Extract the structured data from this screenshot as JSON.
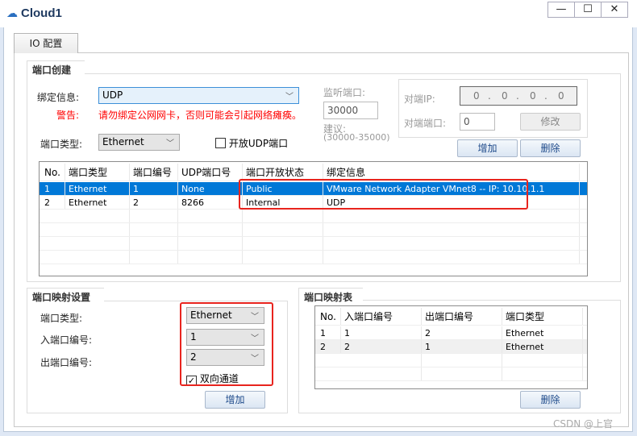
{
  "window": {
    "title": "Cloud1",
    "controls": [
      "—",
      "☐",
      "✕"
    ]
  },
  "tab": {
    "label": "IO 配置"
  },
  "creation": {
    "title": "端口创建",
    "bind_label": "绑定信息:",
    "bind_value": "UDP",
    "warning_label": "警告:",
    "warning_text": "请勿绑定公网网卡，否则可能会引起网络瘫痪。",
    "port_type_label": "端口类型:",
    "port_type_value": "Ethernet",
    "open_udp_label": "开放UDP端口",
    "open_udp_checked": false,
    "listen_label": "监听端口:",
    "listen_value": "30000",
    "suggest_label": "建议:",
    "suggest_range": "(30000-35000)",
    "peer_ip_label": "对端IP:",
    "peer_ip": [
      "0",
      "0",
      "0",
      "0"
    ],
    "peer_port_label": "对端端口:",
    "peer_port_value": "0",
    "modify_button": "修改",
    "add_button": "增加",
    "delete_button": "删除",
    "table": {
      "headers": [
        "No.",
        "端口类型",
        "端口编号",
        "UDP端口号",
        "端口开放状态",
        "绑定信息"
      ],
      "rows": [
        [
          "1",
          "Ethernet",
          "1",
          "None",
          "Public",
          "VMware Network Adapter VMnet8 -- IP: 10.10.1.1"
        ],
        [
          "2",
          "Ethernet",
          "2",
          "8266",
          "Internal",
          "UDP"
        ]
      ],
      "selected_row": 1
    }
  },
  "mapping": {
    "title": "端口映射设置",
    "port_type_label": "端口类型:",
    "port_type_value": "Ethernet",
    "in_label": "入端口编号:",
    "in_value": "1",
    "out_label": "出端口编号:",
    "out_value": "2",
    "bidir_label": "双向通道",
    "bidir_checked": true,
    "add_button": "增加"
  },
  "map_table": {
    "title": "端口映射表",
    "headers": [
      "No.",
      "入端口编号",
      "出端口编号",
      "端口类型"
    ],
    "rows": [
      [
        "1",
        "1",
        "2",
        "Ethernet"
      ],
      [
        "2",
        "2",
        "1",
        "Ethernet"
      ]
    ],
    "delete_button": "删除"
  },
  "watermark": "CSDN @上官",
  "colors": {
    "selection": "#0078d7",
    "warning": "#ff0000",
    "highlight_box": "#e8241e"
  }
}
